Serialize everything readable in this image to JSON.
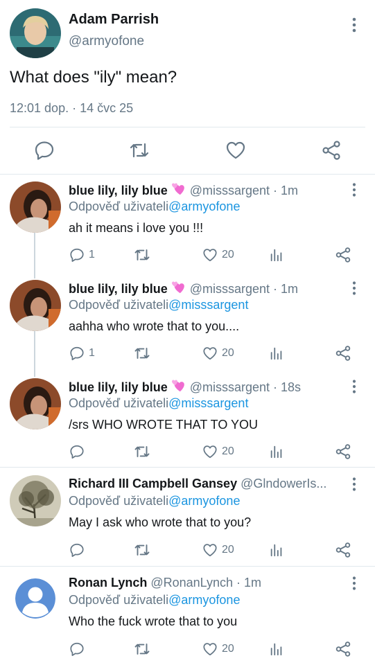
{
  "main": {
    "name": "Adam Parrish",
    "handle": "@armyofone",
    "text": "What does \"ily\" mean?",
    "time": "12:01 dop. · 14 čvc 25"
  },
  "replies": [
    {
      "name": "blue lily, lily blue",
      "emoji": "two-hearts-icon",
      "meta": "@misssargent · 1m",
      "reply_prefix": "Odpověď uživateli",
      "mention": "@armyofone",
      "text": "ah it means i love you !!!",
      "replies": "1",
      "likes": "20"
    },
    {
      "name": "blue lily, lily blue",
      "emoji": "two-hearts-icon",
      "meta": "@misssargent · 1m",
      "reply_prefix": "Odpověď uživateli",
      "mention": "@misssargent",
      "text": "aahha who wrote that to you....",
      "replies": "1",
      "likes": "20"
    },
    {
      "name": "blue lily, lily blue",
      "emoji": "two-hearts-icon",
      "meta": "@misssargent · 18s",
      "reply_prefix": "Odpověď uživateli",
      "mention": "@misssargent",
      "text": "/srs WHO WROTE THAT TO YOU",
      "replies": "",
      "likes": "20"
    },
    {
      "name": "Richard III Campbell Gansey",
      "meta": "@GlndowerIs...",
      "reply_prefix": "Odpověď uživateli",
      "mention": "@armyofone",
      "text": "May I ask who wrote that to you?",
      "replies": "",
      "likes": "20"
    },
    {
      "name": "Ronan Lynch",
      "meta": "@RonanLynch · 1m",
      "reply_prefix": "Odpověď uživateli",
      "mention": "@armyofone",
      "text": "Who the fuck wrote that to you",
      "replies": "",
      "likes": "20"
    }
  ],
  "colors": {
    "text": "#14171a",
    "secondary": "#657786",
    "link": "#1b95e0",
    "divider": "#e1e8ed",
    "heart_emoji": "#f06bd0",
    "default_avatar": "#5b8fd6"
  }
}
